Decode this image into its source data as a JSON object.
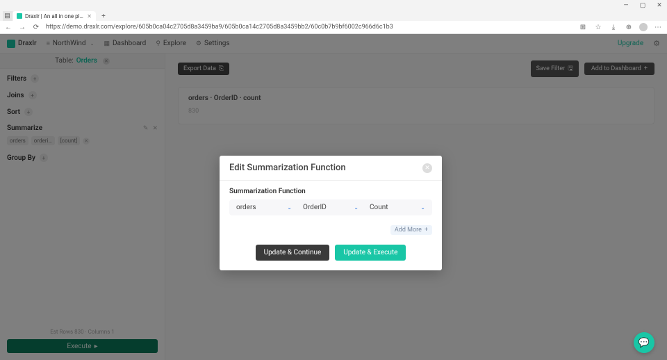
{
  "browser": {
    "tab_title": "Draxlr | An all in one platform to",
    "url": "https://demo.draxlr.com/explore/605b0ca04c2705d8a3459ba9/605b0ca14c2705d8a3459bb2/60c0b7b9bf6002c966d6c1b3",
    "window": {
      "min": "—",
      "max": "▢",
      "close": "✕"
    },
    "nav": {
      "back": "←",
      "fwd": "→",
      "reload": "⟳"
    },
    "tools": {
      "ext": "⊞",
      "fav": "☆",
      "shop": "⤓",
      "collections": "⊕",
      "more": "⋯"
    }
  },
  "nav": {
    "brand": "Draxlr",
    "db": "NorthWind",
    "items": {
      "dashboard": "Dashboard",
      "explore": "Explore",
      "settings": "Settings"
    },
    "upgrade": "Upgrade",
    "icons": {
      "db": "≡",
      "dashboard": "▦",
      "explore": "⚲",
      "settings": "⚙"
    }
  },
  "sidebar": {
    "table_label": "Table:",
    "table_name": "Orders",
    "filters": "Filters",
    "joins": "Joins",
    "sort": "Sort",
    "summarize": "Summarize",
    "sum_tag": {
      "a": "orders",
      "b": "orderi…",
      "c": "[count]"
    },
    "group_by": "Group By",
    "footer_note": "Est Rows 830 · Columns 1",
    "execute": "Execute"
  },
  "main": {
    "export": "Export Data",
    "save_filter": "Save Filter",
    "add_dashboard": "Add to Dashboard",
    "result_head": "orders · OrderID · count",
    "result_val": "830"
  },
  "modal": {
    "title": "Edit Summarization Function",
    "label": "Summarization Function",
    "sel1": "orders",
    "sel2": "OrderID",
    "sel3": "Count",
    "add_more": "Add More",
    "btn_update_continue": "Update & Continue",
    "btn_update_execute": "Update & Execute"
  },
  "glyph": {
    "plus": "+",
    "x": "✕",
    "edit": "✎",
    "chev": "⌄",
    "save": "🖫",
    "chat": "💬",
    "play": "▸"
  }
}
